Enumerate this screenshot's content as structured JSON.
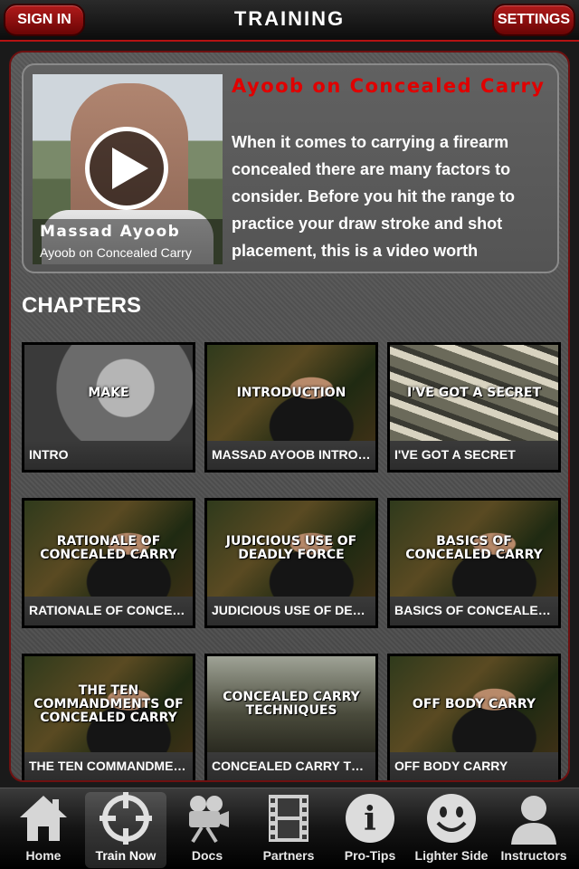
{
  "header": {
    "title": "TRAINING",
    "sign_in_label": "SIGN IN",
    "settings_label": "SETTINGS"
  },
  "featured": {
    "thumb_name": "Massad Ayoob",
    "thumb_subtitle": "Ayoob on Concealed Carry",
    "title": "Ayoob on Concealed Carry",
    "description": "When it comes to carrying a firearm concealed there are many factors to consider. Before you hit the range to practice your draw stroke and shot placement, this is a video worth",
    "play_icon": "play-icon"
  },
  "chapters": {
    "heading": "CHAPTERS",
    "items": [
      {
        "label": "INTRO",
        "overlay": "MAKE"
      },
      {
        "label": "MASSAD AYOOB INTRODU...",
        "overlay": "INTRODUCTION"
      },
      {
        "label": "I'VE GOT A SECRET",
        "overlay": "I'VE GOT A SECRET"
      },
      {
        "label": "RATIONALE OF CONCEALE...",
        "overlay": "RATIONALE OF CONCEALED CARRY"
      },
      {
        "label": "JUDICIOUS USE OF DEADL...",
        "overlay": "JUDICIOUS USE OF DEADLY FORCE"
      },
      {
        "label": "BASICS OF CONCEALED CA...",
        "overlay": "BASICS OF CONCEALED CARRY"
      },
      {
        "label": "THE TEN COMMANDMENTS...",
        "overlay": "THE TEN COMMANDMENTS OF CONCEALED CARRY"
      },
      {
        "label": "CONCEALED CARRY TECHN...",
        "overlay": "CONCEALED CARRY TECHNIQUES"
      },
      {
        "label": "OFF BODY CARRY",
        "overlay": "OFF BODY CARRY"
      }
    ]
  },
  "tabs": [
    {
      "label": "Home",
      "icon": "home-icon"
    },
    {
      "label": "Train Now",
      "icon": "crosshair-icon",
      "active": true
    },
    {
      "label": "Docs",
      "icon": "camera-icon"
    },
    {
      "label": "Partners",
      "icon": "film-icon"
    },
    {
      "label": "Pro-Tips",
      "icon": "info-icon"
    },
    {
      "label": "Lighter Side",
      "icon": "smiley-icon"
    },
    {
      "label": "Instructors",
      "icon": "person-icon"
    }
  ],
  "colors": {
    "accent_red": "#b51212",
    "title_red": "#e00000"
  }
}
